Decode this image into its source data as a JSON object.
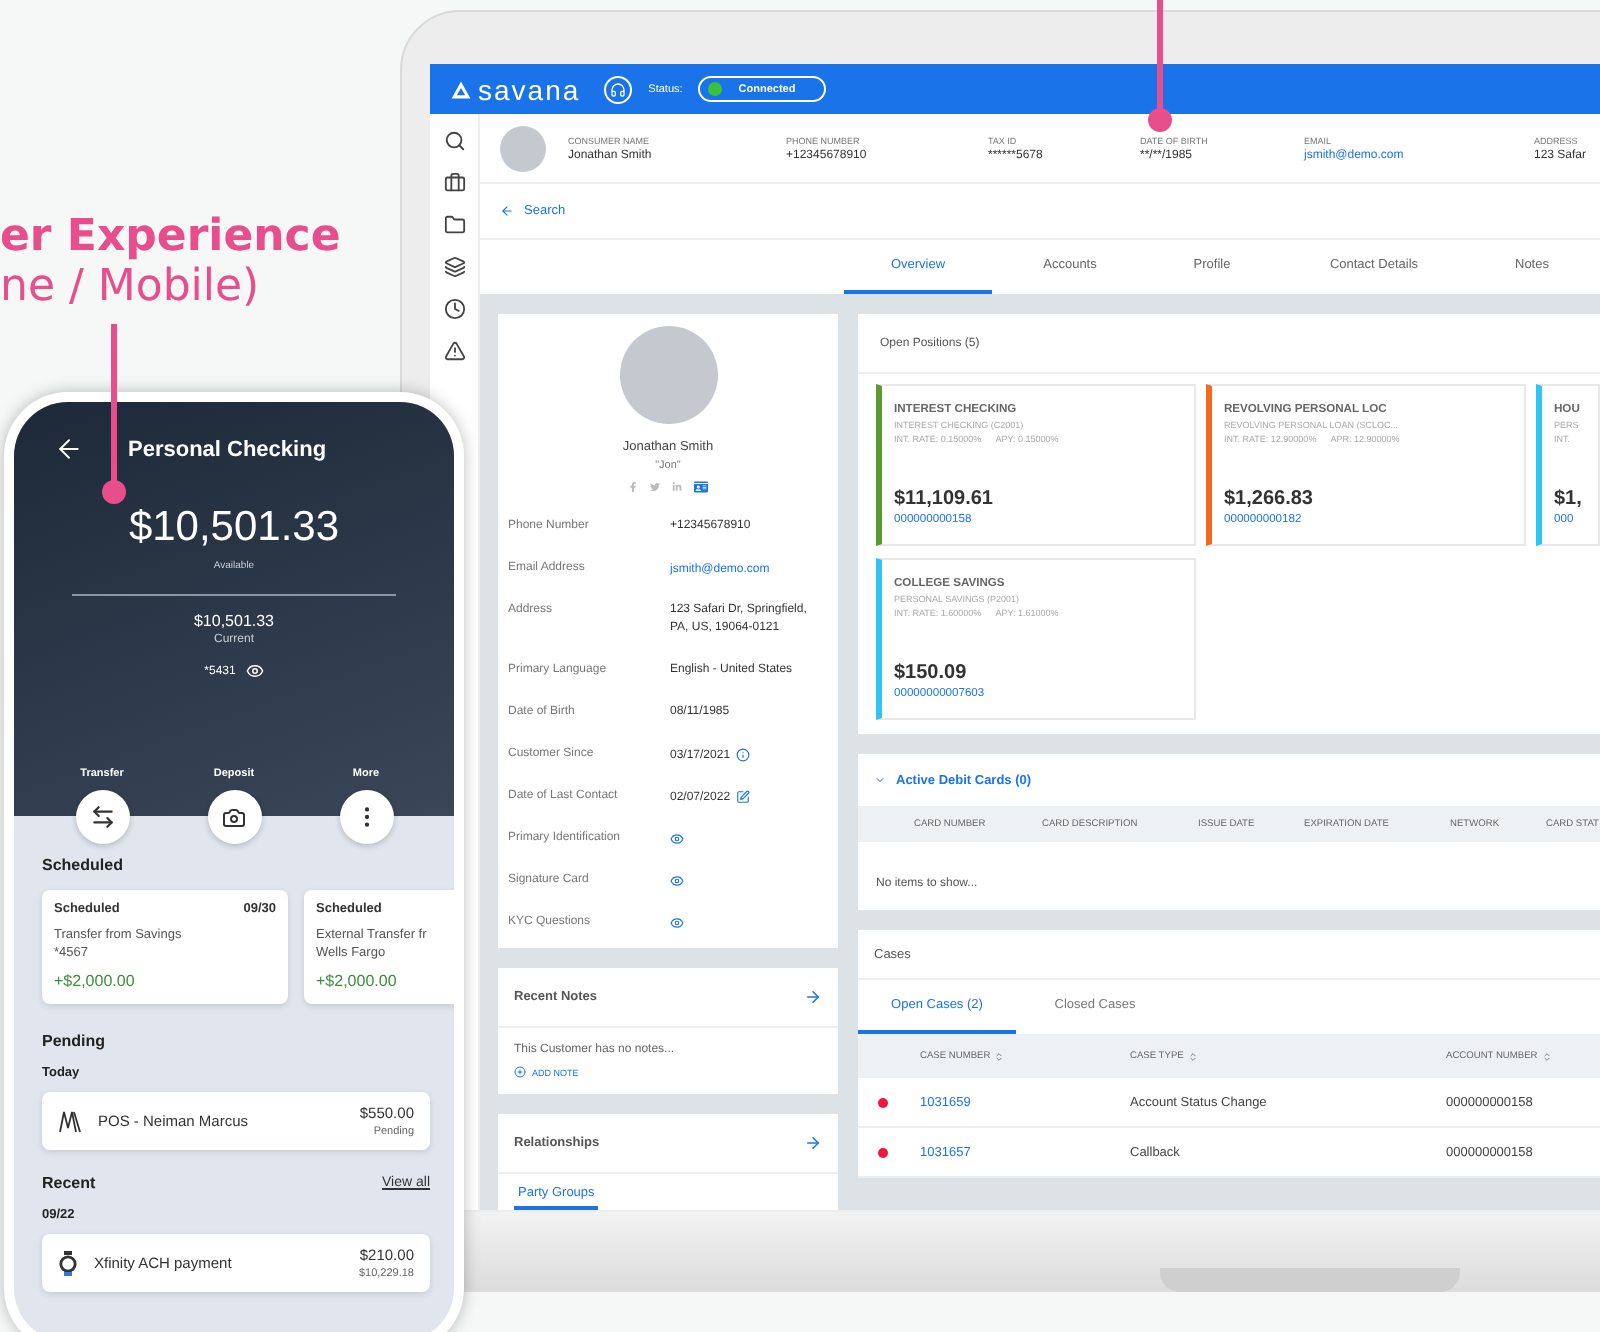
{
  "callout": {
    "line_1": "er Experience",
    "line_2": "ne / Mobile)"
  },
  "laptop": {
    "brand": "savana",
    "status_label": "Status:",
    "status": "Connected",
    "consumer_fields": [
      {
        "label": "CONSUMER NAME",
        "value": "Jonathan Smith",
        "kind": "text"
      },
      {
        "label": "PHONE NUMBER",
        "value": "+12345678910",
        "kind": "text"
      },
      {
        "label": "TAX ID",
        "value": "******5678",
        "kind": "text"
      },
      {
        "label": "DATE OF BIRTH",
        "value": "**/**/1985",
        "kind": "text"
      },
      {
        "label": "EMAIL",
        "value": "jsmith@demo.com",
        "kind": "link"
      },
      {
        "label": "ADDRESS",
        "value": "123 Safar",
        "kind": "text"
      }
    ],
    "back_link": "Search",
    "tabs": [
      {
        "label": "Overview",
        "selected": true
      },
      {
        "label": "Accounts",
        "selected": false
      },
      {
        "label": "Profile",
        "selected": false
      },
      {
        "label": "Contact Details",
        "selected": false
      },
      {
        "label": "Notes",
        "selected": false
      }
    ],
    "profile": {
      "name": "Jonathan Smith",
      "nickname": "\"Jon\"",
      "details": [
        {
          "label": "Phone Number",
          "value": "+12345678910",
          "kind": "text"
        },
        {
          "label": "Email Address",
          "value": "jsmith@demo.com",
          "kind": "link"
        },
        {
          "label": "Address",
          "value": "123 Safari Dr, Springfield, PA, US, 19064-0121",
          "kind": "text"
        },
        {
          "label": "Primary Language",
          "value": "English - United States",
          "kind": "text"
        },
        {
          "label": "Date of Birth",
          "value": "08/11/1985",
          "kind": "text"
        },
        {
          "label": "Customer Since",
          "value": "03/17/2021",
          "kind": "info"
        },
        {
          "label": "Date of Last Contact",
          "value": "02/07/2022",
          "kind": "edit"
        },
        {
          "label": "Primary Identification",
          "kind": "view"
        },
        {
          "label": "Signature Card",
          "kind": "view"
        },
        {
          "label": "KYC Questions",
          "kind": "view"
        }
      ]
    },
    "recent_notes": {
      "title": "Recent Notes",
      "empty": "This Customer has no notes...",
      "action": "ADD NOTE"
    },
    "relationships": {
      "title": "Relationships",
      "tabs": [
        {
          "label": "Party Groups",
          "selected": true
        }
      ]
    },
    "open_positions": {
      "title": "Open Positions (5)",
      "cards": [
        {
          "title": "INTEREST CHECKING",
          "product": "INTEREST CHECKING (C2001)",
          "rate": "INT. RATE: 0.15000%",
          "yield": "APY: 0.15000%",
          "balance": "$11,109.61",
          "account": "000000000158",
          "color": "#5a9a2e"
        },
        {
          "title": "REVOLVING PERSONAL LOC",
          "product": "REVOLVING PERSONAL LOAN (SCLOC...",
          "rate": "INT. RATE: 12.90000%",
          "yield": "APR: 12.90000%",
          "balance": "$1,266.83",
          "account": "000000000182",
          "color": "#f26a1b"
        },
        {
          "title": "HOU",
          "product": "PERS",
          "rate": "INT.",
          "balance": "$1,",
          "account": "000",
          "color": "#2ec5f5"
        },
        {
          "title": "COLLEGE SAVINGS",
          "product": "PERSONAL SAVINGS (P2001)",
          "rate": "INT. RATE: 1.60000%",
          "yield": "APY: 1.61000%",
          "balance": "$150.09",
          "account": "00000000007603",
          "color": "#2ec5f5"
        }
      ]
    },
    "debit_cards": {
      "title": "Active Debit Cards (0)",
      "expanded": true,
      "columns": [
        "CARD NUMBER",
        "CARD DESCRIPTION",
        "ISSUE DATE",
        "EXPIRATION DATE",
        "NETWORK",
        "CARD STAT"
      ],
      "empty": "No items to show..."
    },
    "cases": {
      "title": "Cases",
      "tabs": [
        {
          "label": "Open Cases (2)",
          "selected": true
        },
        {
          "label": "Closed Cases",
          "selected": false
        }
      ],
      "columns": [
        "CASE NUMBER",
        "CASE TYPE",
        "ACCOUNT NUMBER"
      ],
      "rows": [
        {
          "number": "1031659",
          "type": "Account Status Change",
          "account": "000000000158",
          "color": "#f0163c"
        },
        {
          "number": "1031657",
          "type": "Callback",
          "account": "000000000158",
          "color": "#f0163c"
        }
      ]
    }
  },
  "phone": {
    "title": "Personal Checking",
    "balance": "$10,501.33",
    "balance_label": "Available",
    "current": "$10,501.33",
    "current_label": "Current",
    "account_mask": "*5431",
    "actions": [
      {
        "label": "Transfer",
        "kind": "transfer"
      },
      {
        "label": "Deposit",
        "kind": "deposit"
      },
      {
        "label": "More",
        "kind": "more"
      }
    ],
    "scheduled_title": "Scheduled",
    "scheduled": [
      {
        "status": "Scheduled",
        "date": "09/30",
        "description": "Transfer from Savings",
        "detail": "*4567",
        "amount": "+$2,000.00"
      },
      {
        "status": "Scheduled",
        "description": "External Transfer fr",
        "detail": "Wells Fargo",
        "amount": "+$2,000.00"
      }
    ],
    "pending_title": "Pending",
    "pending_day": "Today",
    "pending": [
      {
        "name": "POS - Neiman Marcus",
        "amount": "$550.00",
        "status": "Pending",
        "kind": "monogram"
      }
    ],
    "recent_title": "Recent",
    "view_all": "View all",
    "recent_day": "09/22",
    "recent": [
      {
        "name": "Xfinity ACH payment",
        "amount": "$210.00",
        "status": "$10,229.18",
        "kind": "ring"
      }
    ]
  }
}
